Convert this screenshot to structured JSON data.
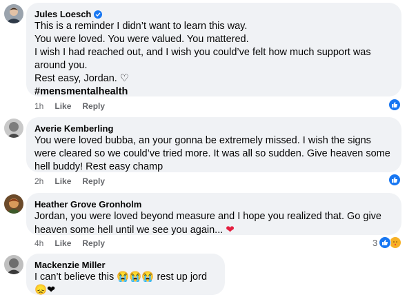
{
  "comments": [
    {
      "author": "Jules Loesch",
      "verified": true,
      "lines": [
        "This is a reminder I didn’t want to learn this way.",
        "You were loved. You were valued. You mattered.",
        "I wish I had reached out, and I wish you could’ve felt how much support was around you.",
        "Rest easy, Jordan. ♡"
      ],
      "hashtag": "#mensmentalhealth",
      "time": "1h",
      "like_label": "Like",
      "reply_label": "Reply",
      "reaction": "like-icon"
    },
    {
      "author": "Averie Kemberling",
      "text": "You were loved bubba, an your gonna be extremely missed. I wish the signs were cleared so we could’ve tried more. It was all so sudden. Give heaven some hell buddy! Rest easy champ",
      "time": "2h",
      "like_label": "Like",
      "reply_label": "Reply",
      "reaction": "like-icon"
    },
    {
      "author": "Heather Grove Gronholm",
      "text": "Jordan, you were loved beyond measure and I hope you realized that. Go give heaven some hell until we see you again...",
      "heart": "❤",
      "time": "4h",
      "like_label": "Like",
      "reply_label": "Reply",
      "reaction_count": "3",
      "reaction": "like-icon, care-icon"
    },
    {
      "author": "Mackenzie Miller",
      "text": "I can’t believe this 😭😭😭 rest up jord 😞❤"
    }
  ]
}
